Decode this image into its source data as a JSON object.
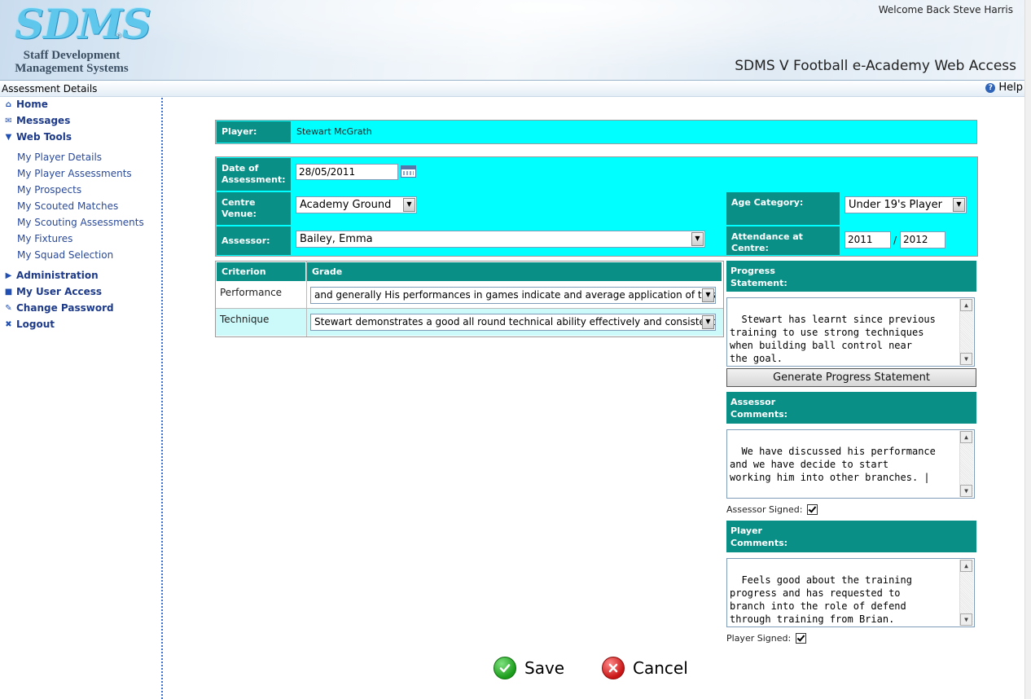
{
  "header": {
    "logo_text": "SDMS",
    "logo_reg": "®",
    "logo_sub_line1": "Staff Development",
    "logo_sub_line2": "Management Systems",
    "welcome": "Welcome Back Steve Harris",
    "app_title": "SDMS V Football e-Academy Web Access"
  },
  "section": {
    "title": "Assessment Details",
    "help_label": "Help"
  },
  "sidebar": {
    "main_items": [
      {
        "label": "Home",
        "icon": "home-icon"
      },
      {
        "label": "Messages",
        "icon": "messages-icon"
      },
      {
        "label": "Web Tools",
        "icon": "expanded-triangle-icon"
      }
    ],
    "sub_items": [
      "My Player Details",
      "My Player Assessments",
      "My Prospects",
      "My Scouted Matches",
      "My Scouting Assessments",
      "My Fixtures",
      "My Squad Selection"
    ],
    "lower_items": [
      {
        "label": "Administration",
        "icon": "collapsed-triangle-icon"
      },
      {
        "label": "My User Access",
        "icon": "lock-icon"
      },
      {
        "label": "Change Password",
        "icon": "key-icon"
      },
      {
        "label": "Logout",
        "icon": "logout-icon"
      }
    ]
  },
  "form": {
    "player_label": "Player:",
    "player_value": "Stewart McGrath",
    "date_label_1": "Date of",
    "date_label_2": "Assessment:",
    "date_value": "28/05/2011",
    "venue_label_1": "Centre",
    "venue_label_2": "Venue:",
    "venue_value": "Academy Ground",
    "age_label": "Age Category:",
    "age_value": "Under 19's Player",
    "assessor_label": "Assessor:",
    "assessor_value": "Bailey, Emma",
    "attendance_label": "Attendance at Centre:",
    "attendance_from": "2011",
    "attendance_sep": "/",
    "attendance_to": "2012"
  },
  "criteria": {
    "headers": [
      "Criterion",
      "Grade"
    ],
    "rows": [
      {
        "criterion": "Performance",
        "grade": "and generally His performances in games indicate and average application of this k"
      },
      {
        "criterion": "Technique",
        "grade": "Stewart demonstrates a good all round technical ability effectively and consistent, w"
      }
    ]
  },
  "progress": {
    "header_1": "Progress",
    "header_2": "Statement:",
    "text": "Stewart has learnt since previous\ntraining to use strong techniques\nwhen building ball control near\nthe goal.",
    "generate_label": "Generate Progress Statement"
  },
  "assessor_comments": {
    "header_1": "Assessor",
    "header_2": "Comments:",
    "text": "We have discussed his performance\nand we have decide to start\nworking him into other branches. |",
    "signed_label": "Assessor Signed:"
  },
  "player_comments": {
    "header_1": "Player",
    "header_2": "Comments:",
    "text": "Feels good about the training\nprogress and has requested to\nbranch into the role of defend\nthrough training from Brian.",
    "signed_label": "Player Signed:"
  },
  "actions": {
    "save_label": "Save",
    "cancel_label": "Cancel"
  },
  "colors": {
    "teal": "#0a8f87",
    "cyan": "#00ffff",
    "nav": "#1e3b8a"
  }
}
